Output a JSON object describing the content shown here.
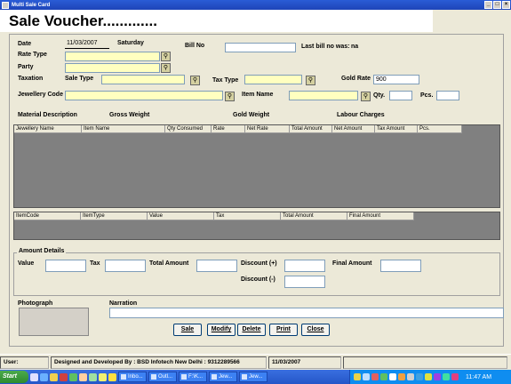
{
  "window": {
    "title": "Multi Sale Card"
  },
  "heading": "Sale Voucher.............",
  "form": {
    "date_label": "Date",
    "date_value": "11/03/2007",
    "day_value": "Saturday",
    "billno_label": "Bill No",
    "billno_value": "",
    "last_bill_label": "Last bill no was:",
    "last_bill_value": "na",
    "ratetype_label": "Rate Type",
    "party_label": "Party",
    "taxation_label": "Taxation",
    "saletype_label": "Sale Type",
    "taxtype_label": "Tax Type",
    "goldrate_label": "Gold Rate",
    "goldrate_value": "900",
    "jewellerycode_label": "Jewellery Code",
    "itemname_label": "Item Name",
    "qty_label": "Qty.",
    "pcs_label": "Pcs.",
    "material_desc_label": "Material Description",
    "gross_weight_label": "Gross Weight",
    "gold_weight_label": "Gold Weight",
    "labour_charges_label": "Labour Charges"
  },
  "grid1": {
    "columns": [
      "Jewellery Name",
      "Item Name",
      "Qty Consumed",
      "Rate",
      "Net Rate",
      "Total Amount",
      "Net Amount",
      "Tax Amount",
      "Pcs."
    ]
  },
  "grid2": {
    "columns": [
      "ItemCode",
      "ItemType",
      "Value",
      "Tax",
      "Total Amount",
      "Final Amount"
    ]
  },
  "amount": {
    "legend": "Amount Details",
    "value_label": "Value",
    "tax_label": "Tax",
    "total_label": "Total Amount",
    "discount_plus_label": "Discount (+)",
    "final_label": "Final Amount",
    "discount_minus_label": "Discount (-)"
  },
  "photo_label": "Photograph",
  "narration_label": "Narration",
  "buttons": {
    "sale": "Sale",
    "modify": "Modify",
    "delete": "Delete",
    "print": "Print",
    "close": "Close"
  },
  "status": {
    "user": "User:",
    "developer": "Designed and Developed By : BSD Infotech New Delhi : 9312289566",
    "date": "11/03/2007"
  },
  "taskbar": {
    "start": "Start",
    "tasks": [
      "Inbo...",
      "Outl...",
      "F:\\K...",
      "Jew...",
      "Jew..."
    ],
    "clock": "11:47 AM"
  }
}
